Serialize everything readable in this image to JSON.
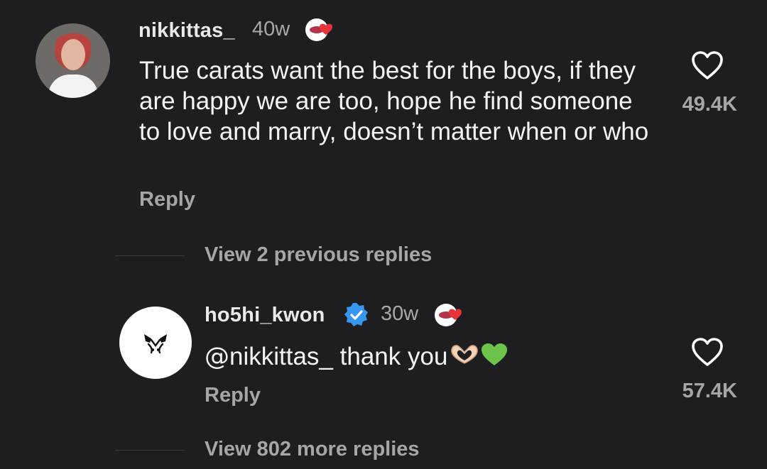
{
  "comment": {
    "username": "nikkittas_",
    "time": "40w",
    "text": "True carats want the best for the boys, if they are happy we are too, hope he find someone to love and marry, doesn’t matter when or who",
    "reply_label": "Reply",
    "likes": "49.4K"
  },
  "view_previous": "View 2 previous replies",
  "reply": {
    "username": "ho5hi_kwon",
    "time": "30w",
    "mention": "nikkittas_",
    "text": " thank you",
    "reply_label": "Reply",
    "likes": "57.4K"
  },
  "view_more": "View 802 more replies",
  "colors": {
    "background": "#1e1e21",
    "verified": "#3797f0",
    "heart_red": "#e8333b",
    "green_heart": "#6cc24a"
  }
}
